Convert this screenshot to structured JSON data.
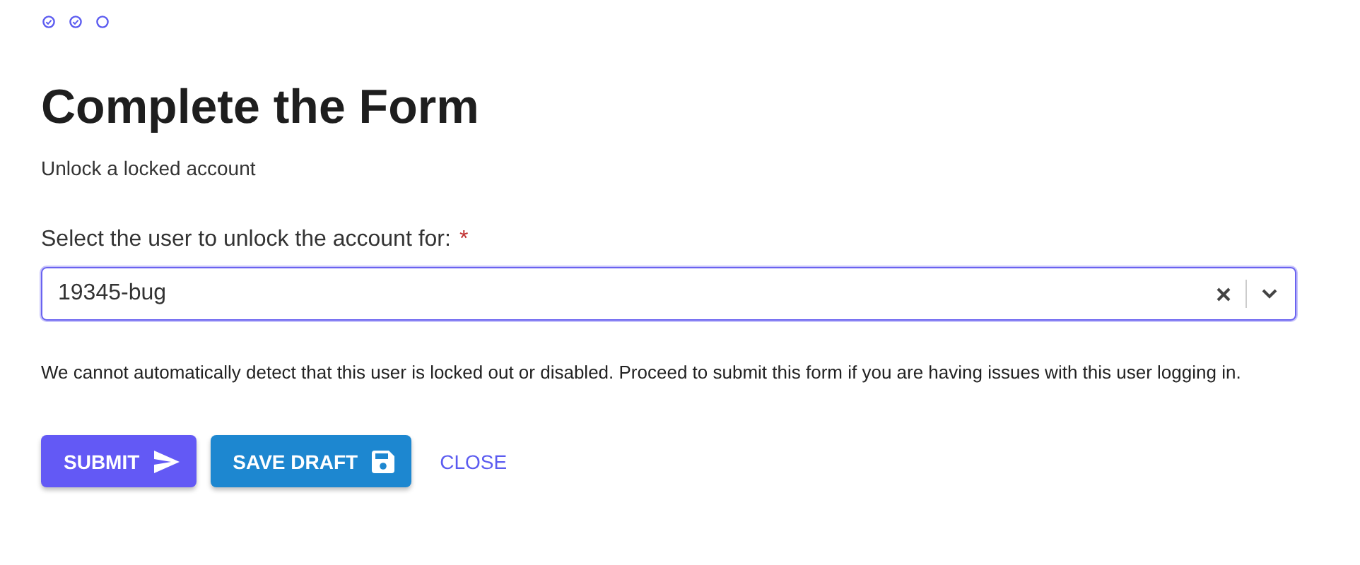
{
  "steps": [
    {
      "done": true
    },
    {
      "done": true
    },
    {
      "done": false
    }
  ],
  "title": "Complete the Form",
  "subtitle": "Unlock a locked account",
  "field": {
    "label": "Select the user to unlock the account for:",
    "required_mark": "*",
    "value": "19345-bug"
  },
  "notice": "We cannot automatically detect that this user is locked out or disabled. Proceed to submit this form if you are having issues with this user logging in.",
  "buttons": [
    {
      "kind": "submit",
      "label": "SUBMIT"
    },
    {
      "kind": "draft",
      "label": "SAVE DRAFT"
    },
    {
      "kind": "link",
      "label": "CLOSE"
    }
  ]
}
